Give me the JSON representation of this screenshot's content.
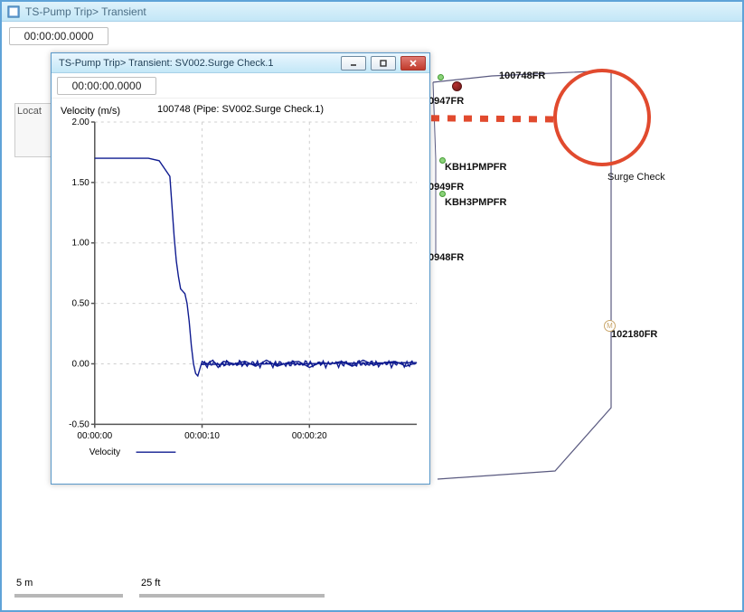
{
  "main_window": {
    "title": "TS-Pump Trip> Transient",
    "time_display": "00:00:00.0000",
    "side_panel_label": "Locat"
  },
  "modal_window": {
    "title": "TS-Pump Trip> Transient: SV002.Surge Check.1",
    "time_display": "00:00:00.0000"
  },
  "map": {
    "scale_m": "5 m",
    "scale_ft": "25 ft",
    "surge_check_label": "Surge Check",
    "labels": {
      "a": "100748FR",
      "b": "0947FR",
      "c": "KBH1PMPFR",
      "d": "0949FR",
      "e": "KBH3PMPFR",
      "f": "0948FR",
      "g": "102180FR"
    },
    "tiny_node_letter": "M"
  },
  "buttons": {
    "minimize": "Minimize",
    "maximize": "Maximize",
    "close": "Close"
  },
  "chart_data": {
    "type": "line",
    "title": "100748 (Pipe: SV002.Surge Check.1)",
    "ylabel": "Velocity (m/s)",
    "legend": [
      "Velocity"
    ],
    "ylim": [
      -0.5,
      2.0
    ],
    "y_ticks": [
      -0.5,
      0.0,
      0.5,
      1.0,
      1.5,
      2.0
    ],
    "x_ticks": [
      "00:00:00",
      "00:00:10",
      "00:00:20"
    ],
    "x_range_s": [
      0,
      30
    ],
    "series": [
      {
        "name": "Velocity",
        "x_seconds": [
          0,
          1,
          2,
          3,
          4,
          5,
          6,
          7,
          7.2,
          7.4,
          7.6,
          7.8,
          8,
          8.2,
          8.4,
          8.6,
          8.8,
          9,
          9.2,
          9.4,
          9.6,
          9.8,
          10,
          10.5,
          11,
          11.5,
          12,
          13,
          14,
          15,
          16,
          17,
          18,
          19,
          20,
          21,
          22,
          23,
          24,
          25,
          26,
          27,
          28,
          29,
          30
        ],
        "values": [
          1.7,
          1.7,
          1.7,
          1.7,
          1.7,
          1.7,
          1.68,
          1.55,
          1.3,
          1.05,
          0.85,
          0.72,
          0.62,
          0.6,
          0.58,
          0.5,
          0.35,
          0.15,
          0.0,
          -0.08,
          -0.1,
          -0.04,
          0.02,
          0.0,
          0.03,
          -0.03,
          0.02,
          0.0,
          0.02,
          -0.02,
          0.03,
          -0.02,
          0.01,
          0.02,
          -0.03,
          0.01,
          0.0,
          0.02,
          -0.02,
          0.03,
          -0.01,
          0.01,
          0.02,
          -0.02,
          0.01
        ]
      }
    ]
  }
}
